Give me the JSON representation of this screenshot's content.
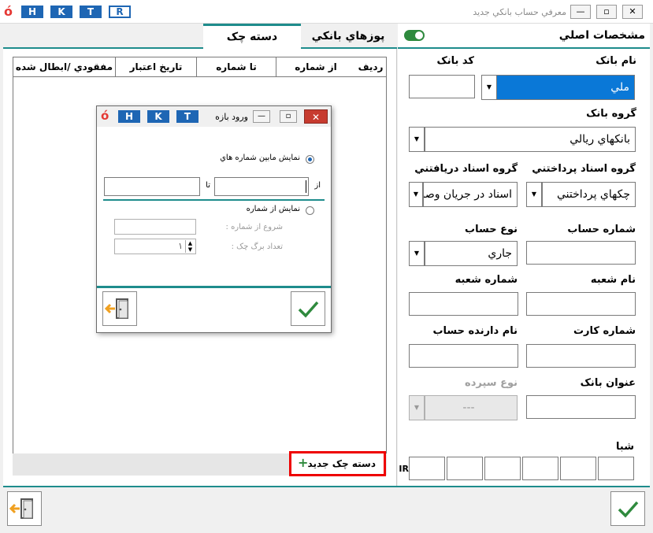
{
  "window": {
    "title": "معرفي حساب بانکي جديد",
    "hotkeys": [
      "H",
      "K",
      "T",
      "R"
    ],
    "app_logo": "ó"
  },
  "left": {
    "tabs": [
      {
        "label": "دسته چک",
        "active": true
      },
      {
        "label": "پوزهاي بانکي",
        "active": false
      }
    ],
    "grid_columns": [
      "رديف",
      "از شماره",
      "تا شماره",
      "تاريخ اعتبار",
      "مفقودي /ابطال شده"
    ],
    "new_button": "دسته چک جديد",
    "new_button_icon": "+"
  },
  "right": {
    "section_title": "مشخصات اصلي",
    "fields": {
      "bank_name_label": "نام بانک",
      "bank_name_value": "ملي",
      "bank_code_label": "کد بانک",
      "bank_group_label": "گروه بانک",
      "bank_group_value": "بانکهاي ريالي",
      "pay_doc_group_label": "گروه اسناد پرداختني",
      "pay_doc_group_value": "چکهاي پرداختني",
      "recv_doc_group_label": "گروه اسناد دريافتني",
      "recv_doc_group_value": "اسناد در جريان وصو",
      "account_no_label": "شماره حساب",
      "account_type_label": "نوع حساب",
      "account_type_value": "جاري",
      "branch_name_label": "نام شعبه",
      "branch_no_label": "شماره شعبه",
      "card_no_label": "شماره کارت",
      "holder_name_label": "نام دارنده حساب",
      "bank_title_label": "عنوان بانک",
      "deposit_type_label": "نوع سپرده",
      "deposit_type_value": "---",
      "sheba_label": "شبا",
      "sheba_prefix": "IR"
    }
  },
  "modal": {
    "title": "ورود بازه",
    "hotkeys": [
      "H",
      "K",
      "T"
    ],
    "close_glyph": "✕",
    "min_glyph": "—",
    "restore_glyph": "▫",
    "option1_label": "نمايش مابين شماره هاي",
    "from_label": "از",
    "to_label": "تا",
    "option2_label": "نمايش از شماره",
    "start_from_label": "شروع از شماره :",
    "sheet_count_label": "تعداد برگ چک :",
    "sheet_count_value": "۱"
  },
  "colors": {
    "accent": "#1e8c8c",
    "selection": "#0a78d7",
    "confirm": "#2f8a3e",
    "exit": "#f0a020",
    "highlight": "#e00000",
    "hotkey": "#1e66b4"
  }
}
